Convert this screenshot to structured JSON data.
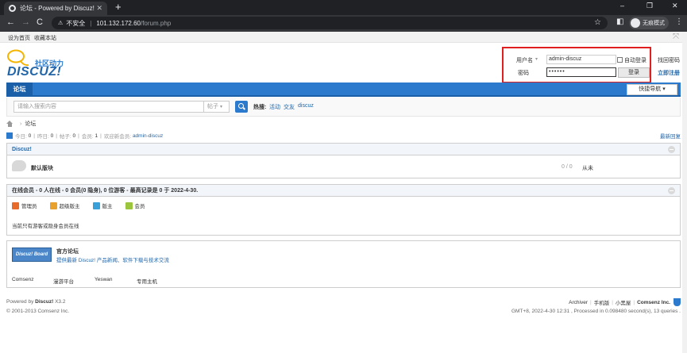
{
  "browser": {
    "tab_title": "论坛 - Powered by Discuz!",
    "tab_close": "✕",
    "new_tab": "+",
    "win_min": "–",
    "win_max": "❐",
    "win_close": "✕",
    "back": "←",
    "forward": "→",
    "reload": "C",
    "security_label": "不安全",
    "url_host": "101.132.172.60",
    "url_path": "/forum.php",
    "profile_label": "无痕模式"
  },
  "topnav": {
    "set_home": "设为首页",
    "bookmark": "收藏本站"
  },
  "logo": {
    "slogan": "社区动力",
    "wordmark": "DISCUZ!"
  },
  "login": {
    "username_label": "用户名",
    "username_value": "admin-discuz",
    "password_label": "密码",
    "password_value": "••••••",
    "remember_label": "自动登录",
    "find_password": "找回密码",
    "submit": "登录",
    "register": "立即注册"
  },
  "nav": {
    "current": "论坛",
    "quick_nav": "快捷导航"
  },
  "search": {
    "placeholder": "请输入搜索内容",
    "type": "帖子",
    "hot_label": "热搜:",
    "hot_terms": [
      "活动",
      "交友",
      "discuz"
    ]
  },
  "breadcrumb": {
    "current": "论坛"
  },
  "stats": {
    "today_label": "今日:",
    "today": "0",
    "yesterday_label": "昨日:",
    "yesterday": "0",
    "posts_label": "帖子:",
    "posts": "0",
    "members_label": "会员:",
    "members": "1",
    "welcome_label": "欢迎新会员:",
    "new_member": "admin-discuz",
    "latest_replies": "最新回复"
  },
  "category": {
    "name": "Discuz!",
    "forum_name": "默认版块",
    "forum_counts": "0 / 0",
    "forum_last": "从未"
  },
  "online": {
    "header": "在线会员 - 0 人在线 - 0 会员(0 隐身), 0 位游客 - 最高记录是 0 于 2022-4-30.",
    "legend": [
      {
        "label": "管理员",
        "color": "#e86b2c"
      },
      {
        "label": "超级版主",
        "color": "#e8a12c"
      },
      {
        "label": "版主",
        "color": "#3aa0d8"
      },
      {
        "label": "会员",
        "color": "#9bc53d"
      }
    ],
    "notice": "当前只有游客或隐身会员在线"
  },
  "links": {
    "logo_text": "Discuz! Board",
    "official_name": "官方论坛",
    "official_desc": "提供最新 Discuz! 产品新闻、软件下载与技术交流",
    "partners": [
      "Comsenz",
      "漫游平台",
      "Yeswan",
      "专用主机"
    ]
  },
  "footer": {
    "powered_prefix": "Powered by ",
    "powered_brand": "Discuz!",
    "powered_version": " X3.2",
    "copyright": "© 2001-2013 Comsenz Inc.",
    "right_links": [
      "Archiver",
      "手机版",
      "小黑屋"
    ],
    "company": "Comsenz Inc.",
    "runtime": "GMT+8, 2022-4-30 12:31 , Processed in 0.098480 second(s), 13 queries ."
  }
}
